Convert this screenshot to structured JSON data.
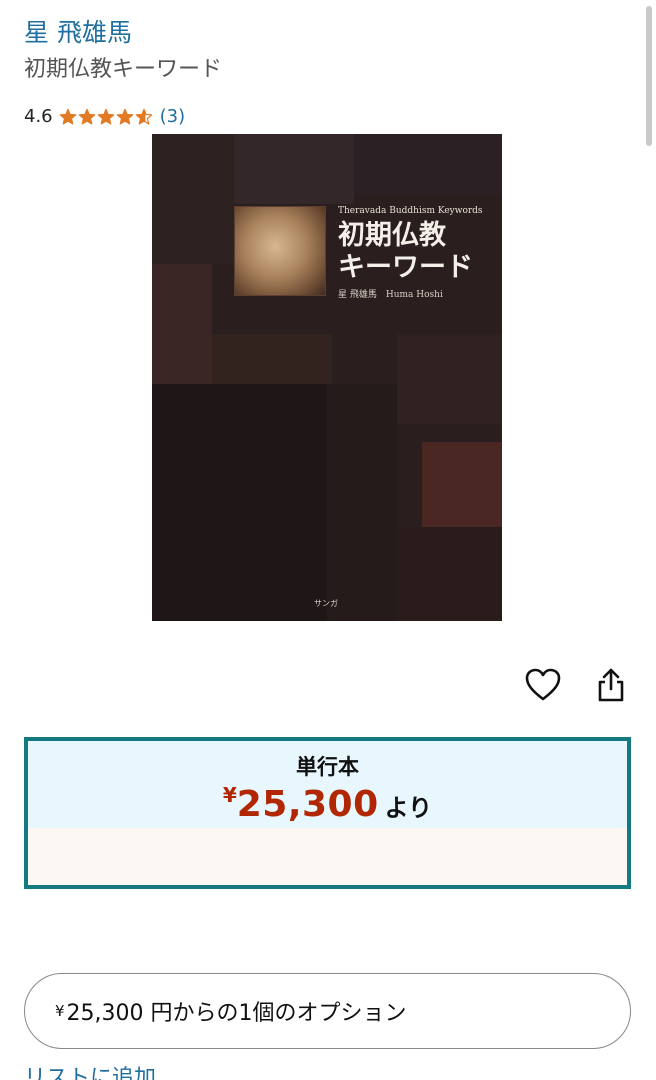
{
  "product": {
    "author": "星 飛雄馬",
    "title": "初期仏教キーワード",
    "rating": {
      "value": "4.6",
      "stars": 4.6,
      "count_label": "(3)"
    }
  },
  "cover": {
    "subtitle_en": "Theravada Buddhism Keywords",
    "title_ja": "初期仏教\nキーワード",
    "author_line": "星 飛雄馬　Huma Hoshi",
    "publisher": "サンガ"
  },
  "actions": {
    "wishlist_icon": "heart-icon",
    "share_icon": "share-icon"
  },
  "format_option": {
    "label": "単行本",
    "currency": "¥",
    "price": "25,300",
    "price_suffix": "より"
  },
  "buy_options": {
    "currency": "¥",
    "label": "25,300 円からの1個のオプション"
  },
  "list_link": {
    "label": "リストに追加"
  },
  "colors": {
    "link": "#1f6fa1",
    "price": "#b12704",
    "star": "#e27a24",
    "format_border": "#147980",
    "format_top_bg": "#e8f6fd",
    "format_bottom_bg": "#fcf7f2"
  }
}
